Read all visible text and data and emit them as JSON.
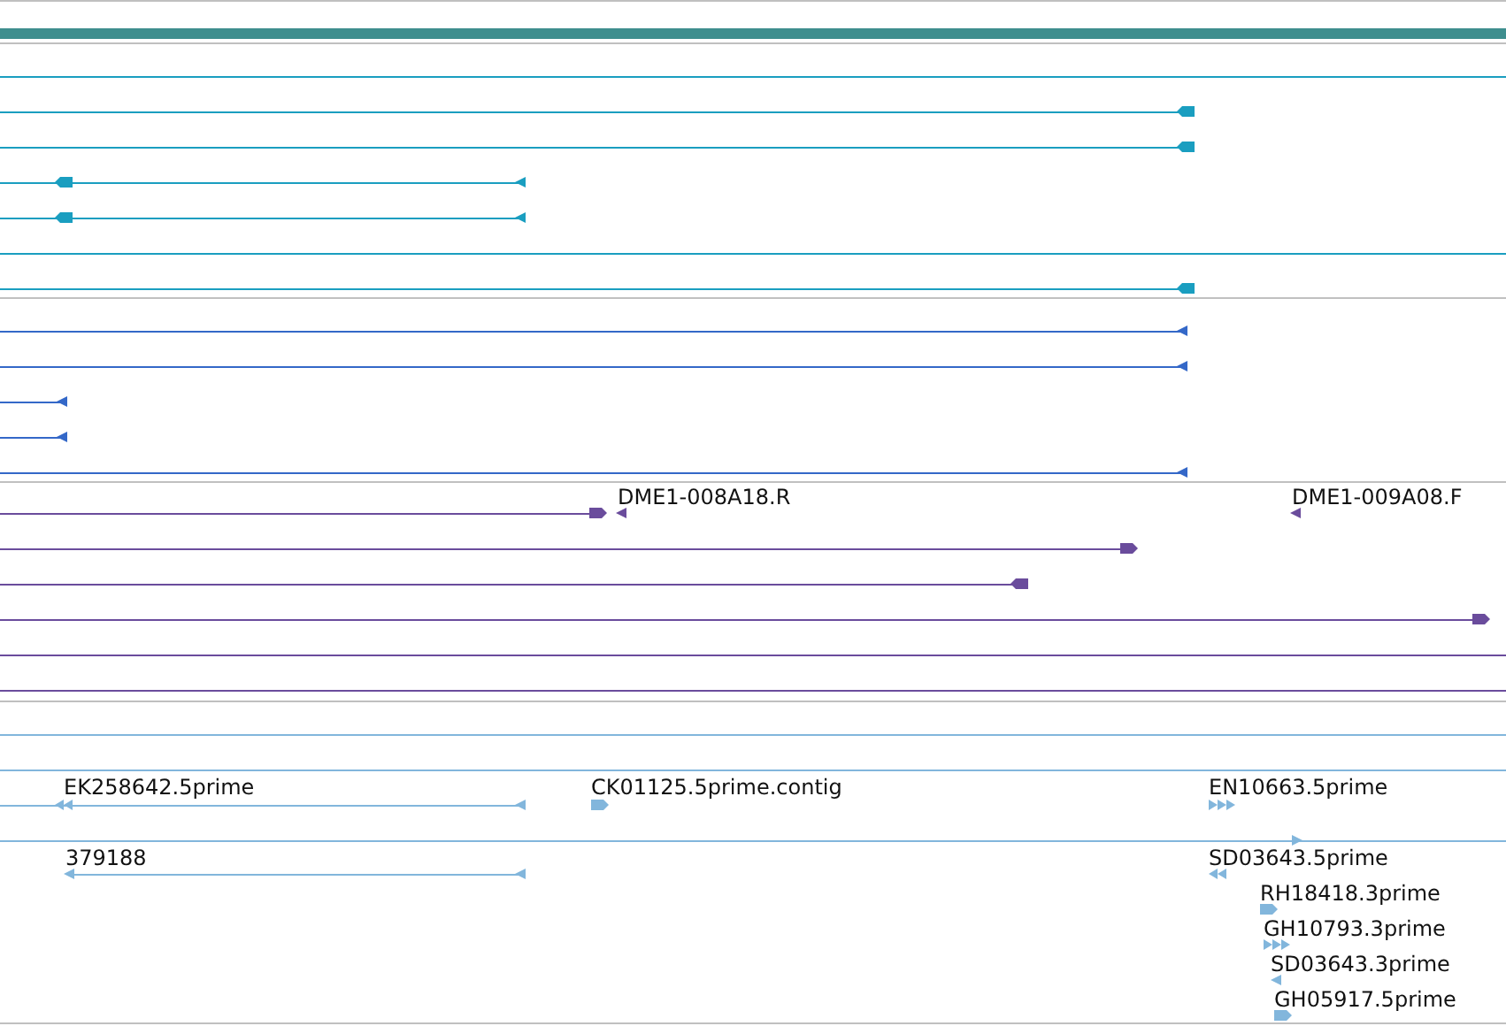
{
  "tracks": [
    {
      "color": "#3e8e8e"
    },
    {
      "color": "#1a9ec0",
      "features": [
        {
          "forward": false
        },
        {
          "forward": false
        },
        {
          "forward": false
        },
        {
          "forward": false
        },
        {
          "forward": false
        }
      ]
    },
    {
      "color": "#3468c8",
      "features": [
        {
          "forward": false
        },
        {
          "forward": false
        },
        {
          "forward": false
        },
        {
          "forward": false
        },
        {
          "forward": false
        }
      ]
    },
    {
      "color": "#6a4c9c",
      "features": [
        {
          "forward": true
        },
        {
          "label": "DME1-008A18.R",
          "forward": false
        },
        {
          "label": "DME1-009A08.F",
          "forward": false
        },
        {
          "forward": true
        },
        {
          "forward": false
        },
        {
          "forward": true
        }
      ]
    },
    {
      "color": "#82b6dc",
      "features": [
        {
          "label": "EK258642.5prime",
          "forward": false
        },
        {
          "label": "CK01125.5prime.contig",
          "forward": true
        },
        {
          "label": "EN10663.5prime",
          "forward": true
        },
        {
          "forward": true
        },
        {
          "label": "379188",
          "forward": false
        },
        {
          "label": "SD03643.5prime",
          "forward": false
        },
        {
          "label": "RH18418.3prime",
          "forward": true
        },
        {
          "label": "GH10793.3prime",
          "forward": true
        },
        {
          "label": "SD03643.3prime",
          "forward": false
        },
        {
          "label": "GH05917.5prime",
          "forward": true
        }
      ]
    }
  ]
}
